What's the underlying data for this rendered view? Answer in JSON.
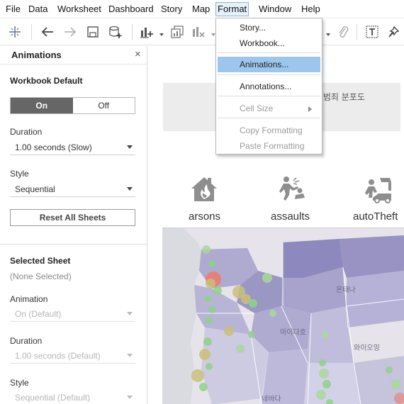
{
  "menubar": {
    "items": [
      "File",
      "Data",
      "Worksheet",
      "Dashboard",
      "Story",
      "Map",
      "Format",
      "Window",
      "Help"
    ],
    "active": "Format"
  },
  "toolbar": {
    "icons": [
      "tableau-logo-icon",
      "back-arrow-icon",
      "forward-arrow-icon",
      "save-icon",
      "add-datasource-icon",
      "new-worksheet-icon",
      "duplicate-sheet-icon",
      "clear-sheet-icon",
      "attach-icon",
      "text-icon",
      "pin-icon"
    ]
  },
  "animations_panel": {
    "title": "Animations",
    "close": "×",
    "workbook_default": {
      "heading": "Workbook Default",
      "toggle_on": "On",
      "toggle_off": "Off",
      "selected": "On",
      "duration_label": "Duration",
      "duration_value": "1.00 seconds (Slow)",
      "style_label": "Style",
      "style_value": "Sequential",
      "reset_button": "Reset All Sheets"
    },
    "selected_sheet": {
      "heading": "Selected Sheet",
      "subtitle": "(None Selected)",
      "animation_label": "Animation",
      "animation_value": "On (Default)",
      "duration_label": "Duration",
      "duration_value": "1.00 seconds (Default)",
      "style_label": "Style",
      "style_value": "Sequential (Default)"
    }
  },
  "format_menu": {
    "items": [
      {
        "label": "Story...",
        "state": "normal"
      },
      {
        "label": "Workbook...",
        "state": "normal"
      },
      {
        "label": "Animations...",
        "state": "highlighted"
      },
      {
        "label": "Annotations...",
        "state": "normal"
      },
      {
        "label": "Cell Size",
        "state": "disabled",
        "submenu": true
      },
      {
        "label": "Copy Formatting",
        "state": "disabled"
      },
      {
        "label": "Paste Formatting",
        "state": "disabled"
      }
    ]
  },
  "dashboard": {
    "title_fragment": "인 범죄 분포도",
    "categories": [
      {
        "label": "arsons",
        "icon": "house-fire-icon"
      },
      {
        "label": "assaults",
        "icon": "assault-icon"
      },
      {
        "label": "autoTheft",
        "icon": "auto-theft-icon"
      }
    ],
    "map_labels": [
      "몬태나",
      "아이다호",
      "와이오밍",
      "네바다"
    ],
    "colors": {
      "state_fill": "#9b97c3",
      "state_fill_light": "#c6c3dd",
      "circle_green": "#8fd18a",
      "circle_olive": "#c9c07a",
      "circle_red": "#ee7a6a"
    }
  }
}
